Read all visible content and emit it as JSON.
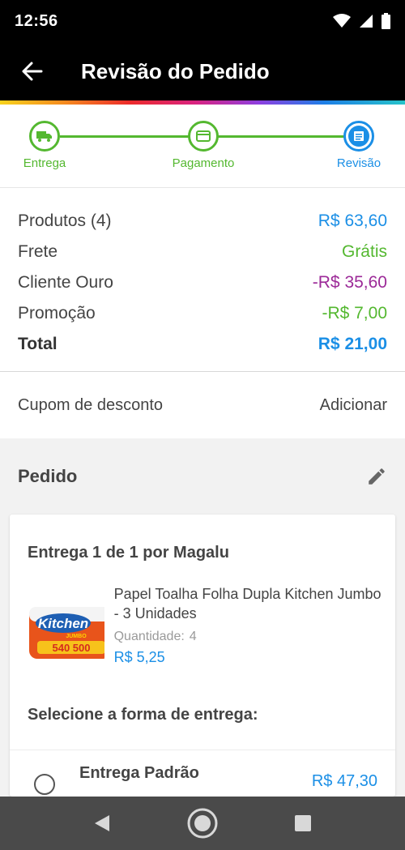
{
  "status_bar": {
    "time": "12:56"
  },
  "header": {
    "title": "Revisão do Pedido"
  },
  "stepper": {
    "steps": [
      {
        "label": "Entrega",
        "icon": "truck-icon"
      },
      {
        "label": "Pagamento",
        "icon": "card-icon"
      },
      {
        "label": "Revisão",
        "icon": "list-icon"
      }
    ],
    "active_step": "Revisão"
  },
  "summary": {
    "rows": [
      {
        "label": "Produtos (4)",
        "value": "R$ 63,60"
      },
      {
        "label": "Frete",
        "value": "Grátis"
      },
      {
        "label": "Cliente Ouro",
        "value": "-R$ 35,60"
      },
      {
        "label": "Promoção",
        "value": "-R$ 7,00"
      },
      {
        "label": "Total",
        "value": "R$ 21,00"
      }
    ]
  },
  "coupon": {
    "label": "Cupom de desconto",
    "action": "Adicionar"
  },
  "order": {
    "title": "Pedido",
    "delivery_title": "Entrega 1 de 1 por Magalu",
    "product": {
      "name": "Papel Toalha Folha Dupla Kitchen Jumbo - 3 Unidades",
      "qty_label": "Quantidade:",
      "qty": "4",
      "price": "R$ 5,25",
      "image_brand": "Kitchen",
      "image_jumbo": "JUMBO",
      "image_promo": "540 500"
    },
    "select_delivery_label": "Selecione a forma de entrega:",
    "option": {
      "name": "Entrega Padrão",
      "price": "R$ 47,30"
    }
  },
  "colors": {
    "green": "#54b830",
    "blue": "#1b8fe6",
    "purple": "#9c2a98",
    "header_bg": "#000000",
    "nav_bg": "#4a4a4a"
  }
}
